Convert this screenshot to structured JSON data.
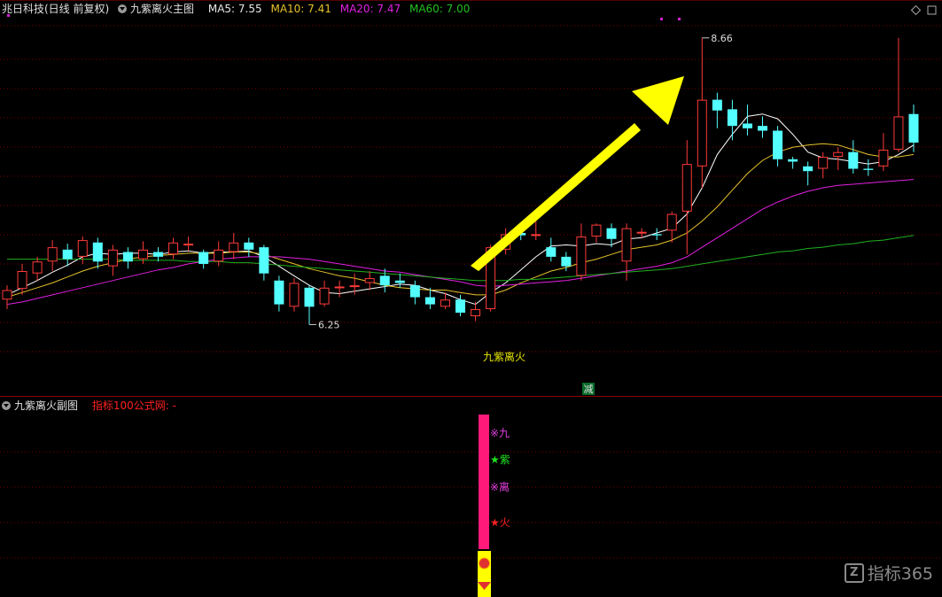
{
  "header": {
    "stock": "兆日科技(日线 前复权)",
    "indicator_name": "九紫离火主图",
    "ma5": "MA5: 7.55",
    "ma10": "MA10: 7.41",
    "ma20": "MA20: 7.47",
    "ma60": "MA60: 7.00"
  },
  "sub_header": {
    "indicator_name": "九紫离火副图",
    "note": "指标100公式网: -"
  },
  "colors": {
    "up": "#ff3a3a",
    "down": "#54ffff",
    "ma5": "#ffffff",
    "ma10": "#e6c22a",
    "ma20": "#e020e0",
    "ma60": "#20b020",
    "grid": "#7a0000",
    "arrow": "#ffff00",
    "signal_bar": "#ff1a7a",
    "signal_base": "#ffff00"
  },
  "annotations": {
    "high_label": "8.66",
    "low_label": "6.25",
    "signal_label": "九紫离火",
    "reduce_label": "减"
  },
  "signal_chars": [
    {
      "text": "※九",
      "color": "#e040e0"
    },
    {
      "text": "★紫",
      "color": "#20e020"
    },
    {
      "text": "※离",
      "color": "#e040e0"
    },
    {
      "text": "★火",
      "color": "#ff2020"
    }
  ],
  "watermark": {
    "text": "指标365",
    "logo": "Z"
  },
  "chart_data": {
    "type": "candlestick",
    "price_range": [
      6.0,
      8.8
    ],
    "high": 8.66,
    "low": 6.25,
    "candles": [
      [
        6.46,
        6.54,
        6.38,
        6.58
      ],
      [
        6.55,
        6.7,
        6.5,
        6.76
      ],
      [
        6.68,
        6.78,
        6.62,
        6.82
      ],
      [
        6.78,
        6.9,
        6.7,
        6.96
      ],
      [
        6.88,
        6.8,
        6.74,
        6.93
      ],
      [
        6.82,
        6.96,
        6.76,
        6.99
      ],
      [
        6.94,
        6.78,
        6.72,
        6.98
      ],
      [
        6.74,
        6.88,
        6.66,
        6.92
      ],
      [
        6.86,
        6.78,
        6.72,
        6.9
      ],
      [
        6.8,
        6.88,
        6.76,
        6.95
      ],
      [
        6.86,
        6.82,
        6.78,
        6.9
      ],
      [
        6.84,
        6.94,
        6.8,
        6.98
      ],
      [
        6.92,
        6.93,
        6.87,
        6.99
      ],
      [
        6.86,
        6.76,
        6.72,
        6.88
      ],
      [
        6.78,
        6.88,
        6.74,
        6.95
      ],
      [
        6.86,
        6.94,
        6.8,
        7.02
      ],
      [
        6.94,
        6.88,
        6.82,
        6.98
      ],
      [
        6.9,
        6.68,
        6.62,
        6.92
      ],
      [
        6.62,
        6.42,
        6.36,
        6.66
      ],
      [
        6.4,
        6.6,
        6.36,
        6.64
      ],
      [
        6.56,
        6.4,
        6.25,
        6.58
      ],
      [
        6.42,
        6.56,
        6.4,
        6.62
      ],
      [
        6.56,
        6.57,
        6.48,
        6.62
      ],
      [
        6.58,
        6.58,
        6.5,
        6.68
      ],
      [
        6.6,
        6.64,
        6.54,
        6.7
      ],
      [
        6.66,
        6.58,
        6.52,
        6.72
      ],
      [
        6.62,
        6.6,
        6.56,
        6.68
      ],
      [
        6.58,
        6.48,
        6.42,
        6.62
      ],
      [
        6.48,
        6.42,
        6.38,
        6.56
      ],
      [
        6.4,
        6.46,
        6.38,
        6.52
      ],
      [
        6.46,
        6.35,
        6.32,
        6.5
      ],
      [
        6.32,
        6.38,
        6.28,
        6.44
      ],
      [
        6.38,
        6.9,
        6.36,
        6.92
      ],
      [
        6.88,
        7.01,
        6.84,
        7.06
      ],
      [
        7.02,
        7.0,
        6.96,
        7.06
      ],
      [
        7.01,
        7.01,
        6.96,
        7.18
      ],
      [
        6.9,
        6.82,
        6.78,
        6.98
      ],
      [
        6.82,
        6.74,
        6.7,
        6.86
      ],
      [
        6.66,
        6.99,
        6.62,
        7.1
      ],
      [
        6.99,
        7.09,
        6.94,
        7.1
      ],
      [
        7.06,
        6.97,
        6.9,
        7.1
      ],
      [
        6.78,
        7.06,
        6.62,
        7.1
      ],
      [
        7.02,
        7.03,
        6.98,
        7.06
      ],
      [
        7.01,
        7.0,
        6.96,
        7.06
      ],
      [
        7.04,
        7.18,
        6.94,
        7.2
      ],
      [
        7.2,
        7.6,
        6.84,
        7.8
      ],
      [
        7.58,
        8.14,
        7.4,
        8.66
      ],
      [
        8.14,
        8.05,
        7.9,
        8.2
      ],
      [
        8.06,
        7.92,
        7.8,
        8.14
      ],
      [
        7.94,
        7.9,
        7.84,
        8.1
      ],
      [
        7.92,
        7.88,
        7.82,
        8.0
      ],
      [
        7.88,
        7.64,
        7.58,
        7.92
      ],
      [
        7.64,
        7.62,
        7.56,
        7.66
      ],
      [
        7.58,
        7.54,
        7.42,
        7.62
      ],
      [
        7.56,
        7.66,
        7.48,
        7.7
      ],
      [
        7.66,
        7.7,
        7.55,
        7.74
      ],
      [
        7.7,
        7.56,
        7.52,
        7.8
      ],
      [
        7.56,
        7.55,
        7.5,
        7.64
      ],
      [
        7.58,
        7.72,
        7.54,
        7.86
      ],
      [
        7.72,
        8.0,
        7.7,
        8.66
      ],
      [
        8.02,
        7.78,
        7.7,
        8.1
      ]
    ],
    "ma_series": [
      {
        "name": "MA5",
        "color": "#ffffff",
        "start": [
          6.5,
          6.56,
          6.62,
          6.69,
          6.75,
          6.82,
          6.85,
          6.84,
          6.85,
          6.85,
          6.84,
          6.86,
          6.87,
          6.85,
          6.86,
          6.86,
          6.87,
          6.82,
          6.74,
          6.66,
          6.58,
          6.52,
          6.51,
          6.53,
          6.55,
          6.57,
          6.59,
          6.58,
          6.54,
          6.51,
          6.46,
          6.42,
          6.52,
          6.6,
          6.71,
          6.82,
          6.91,
          6.92,
          6.91,
          6.93,
          6.92,
          6.97,
          6.98,
          7.02,
          7.06,
          7.18,
          7.4,
          7.68,
          7.85,
          8.0,
          8.02,
          7.98,
          7.85,
          7.7,
          7.65,
          7.64,
          7.62,
          7.6,
          7.62,
          7.68,
          7.76
        ]
      },
      {
        "name": "MA10",
        "color": "#e6c22a",
        "start": [
          6.48,
          6.52,
          6.56,
          6.6,
          6.65,
          6.7,
          6.74,
          6.77,
          6.8,
          6.82,
          6.83,
          6.84,
          6.85,
          6.85,
          6.85,
          6.86,
          6.86,
          6.84,
          6.8,
          6.76,
          6.72,
          6.69,
          6.66,
          6.64,
          6.61,
          6.58,
          6.56,
          6.55,
          6.54,
          6.54,
          6.52,
          6.5,
          6.5,
          6.54,
          6.6,
          6.65,
          6.7,
          6.73,
          6.77,
          6.8,
          6.84,
          6.88,
          6.9,
          6.92,
          6.96,
          7.02,
          7.12,
          7.24,
          7.38,
          7.52,
          7.63,
          7.7,
          7.74,
          7.76,
          7.77,
          7.76,
          7.72,
          7.68,
          7.66,
          7.66,
          7.68
        ]
      },
      {
        "name": "MA20",
        "color": "#e020e0",
        "start": [
          6.42,
          6.44,
          6.47,
          6.5,
          6.53,
          6.56,
          6.59,
          6.62,
          6.65,
          6.68,
          6.71,
          6.73,
          6.76,
          6.78,
          6.8,
          6.81,
          6.82,
          6.82,
          6.82,
          6.81,
          6.8,
          6.78,
          6.76,
          6.74,
          6.72,
          6.7,
          6.69,
          6.67,
          6.65,
          6.63,
          6.61,
          6.58,
          6.57,
          6.58,
          6.59,
          6.6,
          6.61,
          6.62,
          6.64,
          6.66,
          6.68,
          6.7,
          6.72,
          6.74,
          6.77,
          6.82,
          6.9,
          6.98,
          7.06,
          7.14,
          7.22,
          7.28,
          7.33,
          7.37,
          7.4,
          7.42,
          7.43,
          7.44,
          7.45,
          7.46,
          7.47
        ]
      },
      {
        "name": "MA60",
        "color": "#20b020",
        "start": [
          6.8,
          6.8,
          6.8,
          6.8,
          6.8,
          6.8,
          6.8,
          6.8,
          6.79,
          6.79,
          6.79,
          6.79,
          6.78,
          6.78,
          6.78,
          6.77,
          6.77,
          6.76,
          6.75,
          6.74,
          6.73,
          6.72,
          6.71,
          6.7,
          6.69,
          6.68,
          6.67,
          6.66,
          6.65,
          6.64,
          6.63,
          6.62,
          6.62,
          6.62,
          6.63,
          6.63,
          6.64,
          6.65,
          6.66,
          6.67,
          6.68,
          6.69,
          6.7,
          6.71,
          6.72,
          6.74,
          6.76,
          6.78,
          6.8,
          6.82,
          6.84,
          6.86,
          6.87,
          6.89,
          6.9,
          6.92,
          6.93,
          6.95,
          6.96,
          6.98,
          7.0
        ]
      }
    ]
  }
}
